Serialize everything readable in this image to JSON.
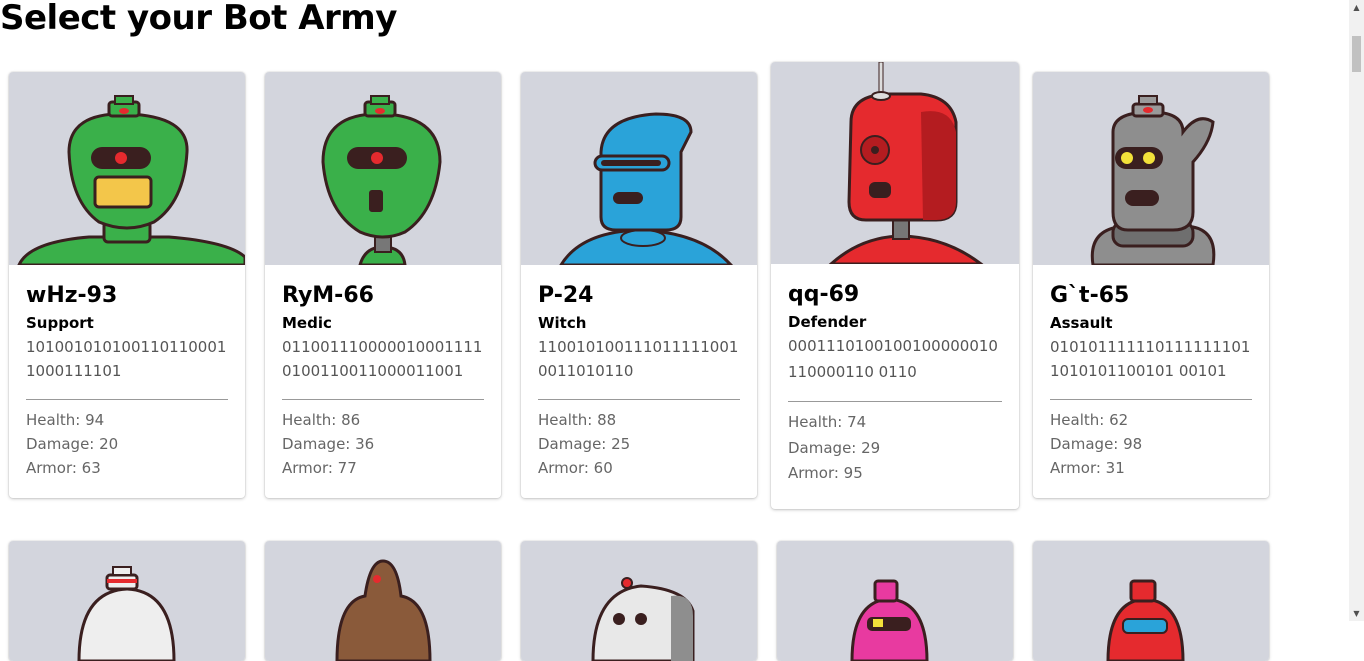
{
  "page": {
    "title": "Select your Bot Army"
  },
  "bots": [
    {
      "name": "wHz-93",
      "class": "Support",
      "code": "1010010101001101100011000111101",
      "health_label": "Health: 94",
      "damage_label": "Damage: 20",
      "armor_label": "Armor: 63",
      "color": "#3ab04a"
    },
    {
      "name": "RyM-66",
      "class": "Medic",
      "code": "0110011100000100011110100110011000011001",
      "health_label": "Health: 86",
      "damage_label": "Damage: 36",
      "armor_label": "Armor: 77",
      "color": "#3ab04a"
    },
    {
      "name": "P-24",
      "class": "Witch",
      "code": "1100101001110111110010011010110",
      "health_label": "Health: 88",
      "damage_label": "Damage: 25",
      "armor_label": "Armor: 60",
      "color": "#2aa3d9"
    },
    {
      "name": "qq-69",
      "class": "Defender",
      "code": "0001110100100100000010110000110 0110",
      "health_label": "Health: 74",
      "damage_label": "Damage: 29",
      "armor_label": "Armor: 95",
      "color": "#e52a2e"
    },
    {
      "name": "G`t-65",
      "class": "Assault",
      "code": "0101011111101111111011010101100101 00101",
      "health_label": "Health: 62",
      "damage_label": "Damage: 98",
      "armor_label": "Armor: 31",
      "color": "#8e8e8e"
    }
  ],
  "bots_row2": [
    {
      "color": "#e8e8e8"
    },
    {
      "color": "#8a5a3a"
    },
    {
      "color": "#e8e8e8"
    },
    {
      "color": "#e83aa0"
    },
    {
      "color": "#e52a2e"
    }
  ]
}
